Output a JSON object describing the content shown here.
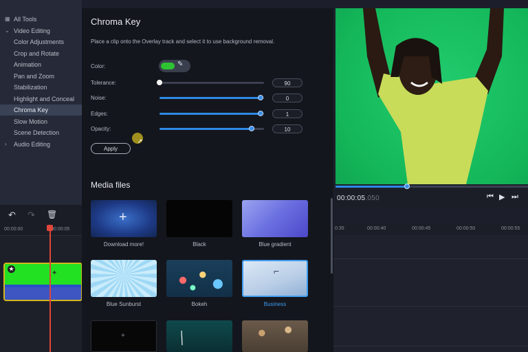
{
  "sidebar": {
    "items": [
      {
        "label": "All Tools",
        "icon": "grid-icon"
      },
      {
        "label": "Video Editing",
        "icon": "chevron-down-icon"
      },
      {
        "label": "Color Adjustments"
      },
      {
        "label": "Crop and Rotate"
      },
      {
        "label": "Animation"
      },
      {
        "label": "Pan and Zoom"
      },
      {
        "label": "Stabilization"
      },
      {
        "label": "Highlight and Conceal"
      },
      {
        "label": "Chroma Key",
        "active": true
      },
      {
        "label": "Slow Motion"
      },
      {
        "label": "Scene Detection"
      },
      {
        "label": "Audio Editing",
        "icon": "chevron-right-icon"
      }
    ]
  },
  "panel": {
    "title": "Chroma Key",
    "description": "Place a clip onto the Overlay track and select it to use background removal.",
    "color_label": "Color:",
    "color_value": "#2ec332",
    "sliders": [
      {
        "label": "Tolerance:",
        "value": "90",
        "level": 0.0
      },
      {
        "label": "Noise:",
        "value": "0",
        "level": 0.97
      },
      {
        "label": "Edges:",
        "value": "1",
        "level": 0.97
      },
      {
        "label": "Opacity:",
        "value": "10",
        "level": 0.88
      }
    ],
    "apply_label": "Apply"
  },
  "media": {
    "title": "Media files",
    "items": [
      {
        "label": "Download more!",
        "icon": "plus-icon"
      },
      {
        "label": "Black"
      },
      {
        "label": "Blue gradient"
      },
      {
        "label": "Blue Sunburst"
      },
      {
        "label": "Bokeh"
      },
      {
        "label": "Business",
        "selected": true
      }
    ]
  },
  "player": {
    "timecode_main": "00:00:05",
    "timecode_frac": ".050",
    "progress": 0.37
  },
  "timeline": {
    "left_ticks": [
      "00:00:00",
      "00:00:05"
    ],
    "right_ticks": [
      "0:35",
      "00:00:40",
      "00:00:45",
      "00:00:50",
      "00:00:55"
    ]
  },
  "colors": {
    "accent": "#2e8ae6",
    "selection": "#3f9cf0",
    "playhead": "#e0463a",
    "clip_border": "#d4b81e"
  }
}
